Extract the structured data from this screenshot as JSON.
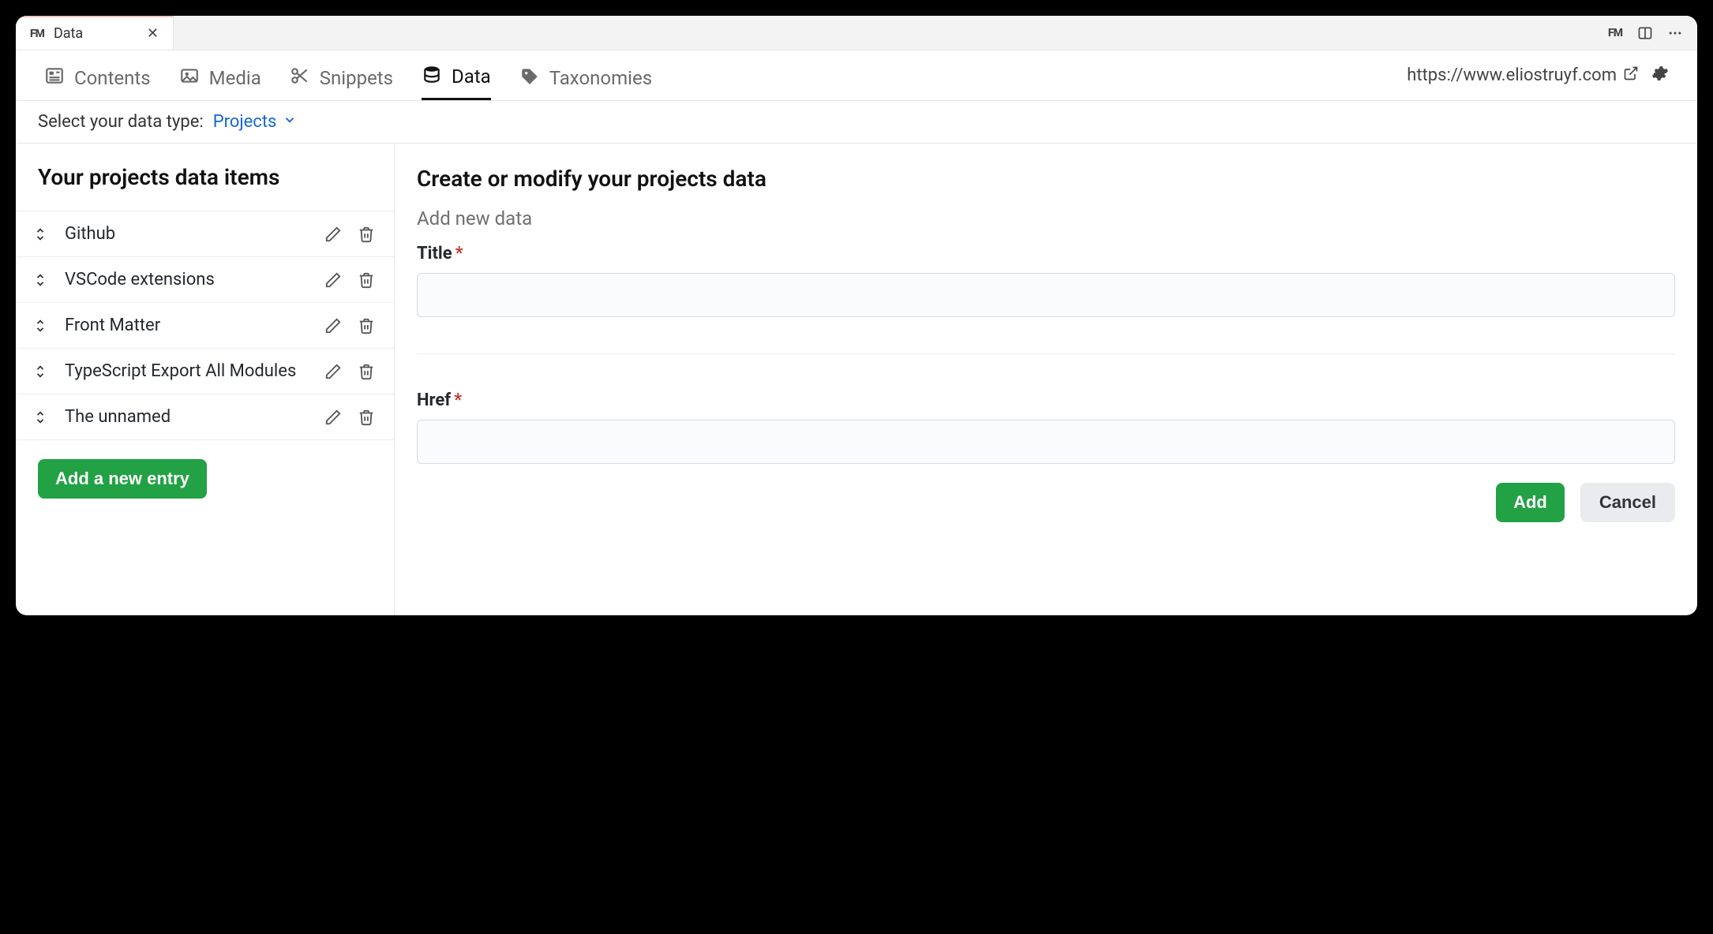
{
  "tab": {
    "title": "Data"
  },
  "nav": {
    "items": [
      {
        "id": "contents",
        "label": "Contents"
      },
      {
        "id": "media",
        "label": "Media"
      },
      {
        "id": "snippets",
        "label": "Snippets"
      },
      {
        "id": "data",
        "label": "Data"
      },
      {
        "id": "taxonomies",
        "label": "Taxonomies"
      }
    ],
    "active": "data",
    "site_url": "https://www.eliostruyf.com"
  },
  "type_selector": {
    "label": "Select your data type:",
    "selected": "Projects"
  },
  "left_panel": {
    "heading": "Your projects data items",
    "add_button": "Add a new entry",
    "items": [
      {
        "name": "Github"
      },
      {
        "name": "VSCode extensions"
      },
      {
        "name": "Front Matter"
      },
      {
        "name": "TypeScript Export All Modules"
      },
      {
        "name": "The unnamed"
      }
    ]
  },
  "form": {
    "heading": "Create or modify your projects data",
    "subtitle": "Add new data",
    "fields": {
      "title": {
        "label": "Title",
        "required": "*",
        "value": ""
      },
      "href": {
        "label": "Href",
        "required": "*",
        "value": ""
      }
    },
    "buttons": {
      "submit": "Add",
      "cancel": "Cancel"
    }
  }
}
